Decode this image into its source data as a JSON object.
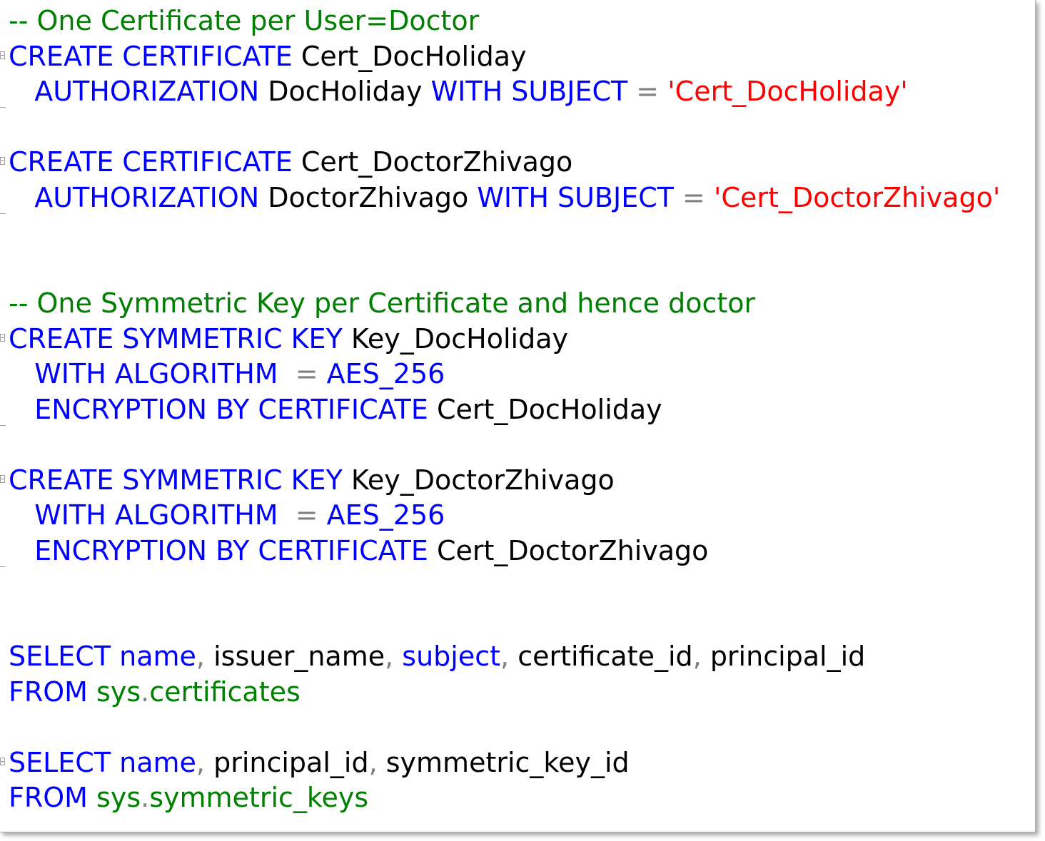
{
  "editor": {
    "lines": [
      {
        "tokens": [
          {
            "t": "-- One Certificate per User=Doctor",
            "c": "cm"
          }
        ]
      },
      {
        "fold": "start",
        "tokens": [
          {
            "t": "CREATE CERTIFICATE",
            "c": "kw"
          },
          {
            "t": " Cert_DocHoliday",
            "c": "id"
          }
        ]
      },
      {
        "fold": "end",
        "tokens": [
          {
            "t": "   AUTHORIZATION",
            "c": "kw"
          },
          {
            "t": " DocHoliday ",
            "c": "id"
          },
          {
            "t": "WITH SUBJECT",
            "c": "kw"
          },
          {
            "t": " = ",
            "c": "op"
          },
          {
            "t": "'Cert_DocHoliday'",
            "c": "str"
          }
        ]
      },
      {
        "tokens": []
      },
      {
        "fold": "start",
        "tokens": [
          {
            "t": "CREATE CERTIFICATE",
            "c": "kw"
          },
          {
            "t": " Cert_DoctorZhivago",
            "c": "id"
          }
        ]
      },
      {
        "fold": "end",
        "tokens": [
          {
            "t": "   AUTHORIZATION",
            "c": "kw"
          },
          {
            "t": " DoctorZhivago ",
            "c": "id"
          },
          {
            "t": "WITH SUBJECT",
            "c": "kw"
          },
          {
            "t": " = ",
            "c": "op"
          },
          {
            "t": "'Cert_DoctorZhivago'",
            "c": "str"
          }
        ]
      },
      {
        "tokens": []
      },
      {
        "tokens": []
      },
      {
        "tokens": [
          {
            "t": "-- One Symmetric Key per Certificate and hence doctor",
            "c": "cm"
          }
        ]
      },
      {
        "fold": "start",
        "tokens": [
          {
            "t": "CREATE SYMMETRIC KEY",
            "c": "kw"
          },
          {
            "t": " Key_DocHoliday",
            "c": "id"
          }
        ]
      },
      {
        "tokens": [
          {
            "t": "   WITH ALGORITHM",
            "c": "kw"
          },
          {
            "t": "  = ",
            "c": "op"
          },
          {
            "t": "AES_256",
            "c": "kw"
          }
        ]
      },
      {
        "fold": "end",
        "tokens": [
          {
            "t": "   ENCRYPTION BY CERTIFICATE",
            "c": "kw"
          },
          {
            "t": " Cert_DocHoliday",
            "c": "id"
          }
        ]
      },
      {
        "tokens": []
      },
      {
        "fold": "start",
        "tokens": [
          {
            "t": "CREATE SYMMETRIC KEY",
            "c": "kw"
          },
          {
            "t": " Key_DoctorZhivago",
            "c": "id"
          }
        ]
      },
      {
        "tokens": [
          {
            "t": "   WITH ALGORITHM",
            "c": "kw"
          },
          {
            "t": "  = ",
            "c": "op"
          },
          {
            "t": "AES_256",
            "c": "kw"
          }
        ]
      },
      {
        "fold": "end",
        "tokens": [
          {
            "t": "   ENCRYPTION BY CERTIFICATE",
            "c": "kw"
          },
          {
            "t": " Cert_DoctorZhivago",
            "c": "id"
          }
        ]
      },
      {
        "tokens": []
      },
      {
        "tokens": []
      },
      {
        "tokens": [
          {
            "t": "SELECT",
            "c": "kw"
          },
          {
            "t": " ",
            "c": "id"
          },
          {
            "t": "name",
            "c": "kw"
          },
          {
            "t": ",",
            "c": "op"
          },
          {
            "t": " issuer_name",
            "c": "id"
          },
          {
            "t": ",",
            "c": "op"
          },
          {
            "t": " ",
            "c": "id"
          },
          {
            "t": "subject",
            "c": "kw"
          },
          {
            "t": ",",
            "c": "op"
          },
          {
            "t": " certificate_id",
            "c": "id"
          },
          {
            "t": ",",
            "c": "op"
          },
          {
            "t": " principal_id",
            "c": "id"
          }
        ]
      },
      {
        "tokens": [
          {
            "t": "FROM",
            "c": "kw"
          },
          {
            "t": " sys",
            "c": "sys"
          },
          {
            "t": ".",
            "c": "op"
          },
          {
            "t": "certificates",
            "c": "sys"
          }
        ]
      },
      {
        "tokens": []
      },
      {
        "fold": "start",
        "tokens": [
          {
            "t": "SELECT",
            "c": "kw"
          },
          {
            "t": " ",
            "c": "id"
          },
          {
            "t": "name",
            "c": "kw"
          },
          {
            "t": ",",
            "c": "op"
          },
          {
            "t": " principal_id",
            "c": "id"
          },
          {
            "t": ",",
            "c": "op"
          },
          {
            "t": " symmetric_key_id",
            "c": "id"
          }
        ]
      },
      {
        "tokens": [
          {
            "t": "FROM",
            "c": "kw"
          },
          {
            "t": " sys",
            "c": "sys"
          },
          {
            "t": ".",
            "c": "op"
          },
          {
            "t": "symmetric_keys",
            "c": "sys"
          }
        ]
      }
    ]
  },
  "colors": {
    "keyword": "#0000ff",
    "identifier": "#000000",
    "string": "#ff0000",
    "comment": "#008000",
    "operator": "#808080",
    "system_object": "#008000"
  }
}
